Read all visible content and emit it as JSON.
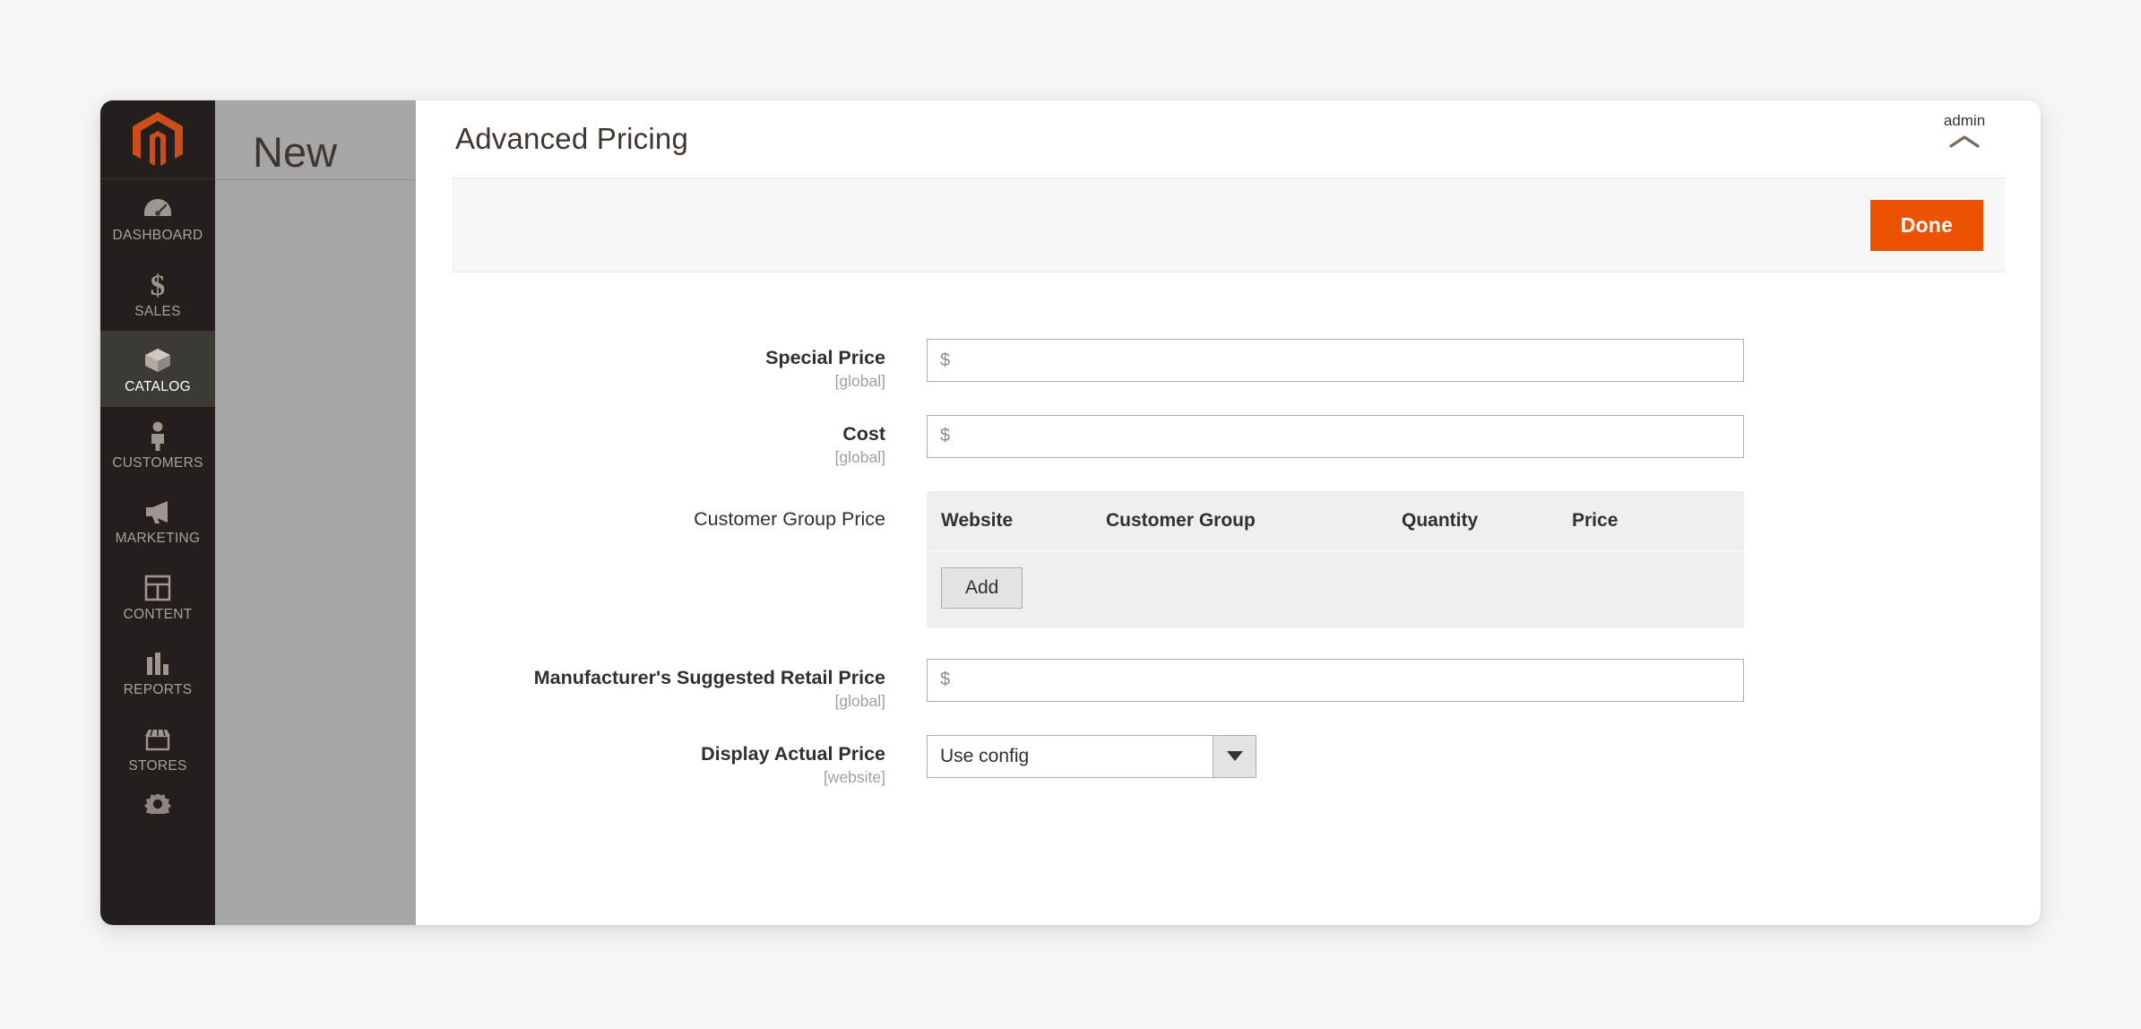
{
  "window": {
    "background_page_title": "New"
  },
  "sidebar": {
    "logo": "magento-logo",
    "items": [
      {
        "label": "DASHBOARD",
        "icon": "dashboard-gauge-icon",
        "active": false
      },
      {
        "label": "SALES",
        "icon": "dollar-sign-icon",
        "active": false
      },
      {
        "label": "CATALOG",
        "icon": "box-icon",
        "active": true
      },
      {
        "label": "CUSTOMERS",
        "icon": "person-icon",
        "active": false
      },
      {
        "label": "MARKETING",
        "icon": "megaphone-icon",
        "active": false
      },
      {
        "label": "CONTENT",
        "icon": "layout-grid-icon",
        "active": false
      },
      {
        "label": "REPORTS",
        "icon": "bar-chart-icon",
        "active": false
      },
      {
        "label": "STORES",
        "icon": "storefront-icon",
        "active": false
      },
      {
        "label": "",
        "icon": "gear-icon",
        "active": false
      }
    ]
  },
  "modal": {
    "title": "Advanced Pricing",
    "admin_label": "admin",
    "collapse_icon": "chevron-up-icon",
    "done_label": "Done"
  },
  "form": {
    "special_price": {
      "label": "Special Price",
      "scope": "[global]",
      "value": "",
      "placeholder": "$"
    },
    "cost": {
      "label": "Cost",
      "scope": "[global]",
      "value": "",
      "placeholder": "$"
    },
    "customer_group_price": {
      "label": "Customer Group Price",
      "columns": [
        "Website",
        "Customer Group",
        "Quantity",
        "Price"
      ],
      "rows": [],
      "add_label": "Add"
    },
    "msrp": {
      "label": "Manufacturer's Suggested Retail Price",
      "scope": "[global]",
      "value": "",
      "placeholder": "$"
    },
    "display_actual_price": {
      "label": "Display Actual Price",
      "scope": "[website]",
      "value": "Use config",
      "options": [
        "Use config"
      ]
    }
  },
  "colors": {
    "accent_orange": "#eb5202",
    "sidebar_dark": "#241f1c",
    "sidebar_active": "#3d3935",
    "overlay_gray": "#a6a6a6",
    "table_gray": "#efefef"
  }
}
